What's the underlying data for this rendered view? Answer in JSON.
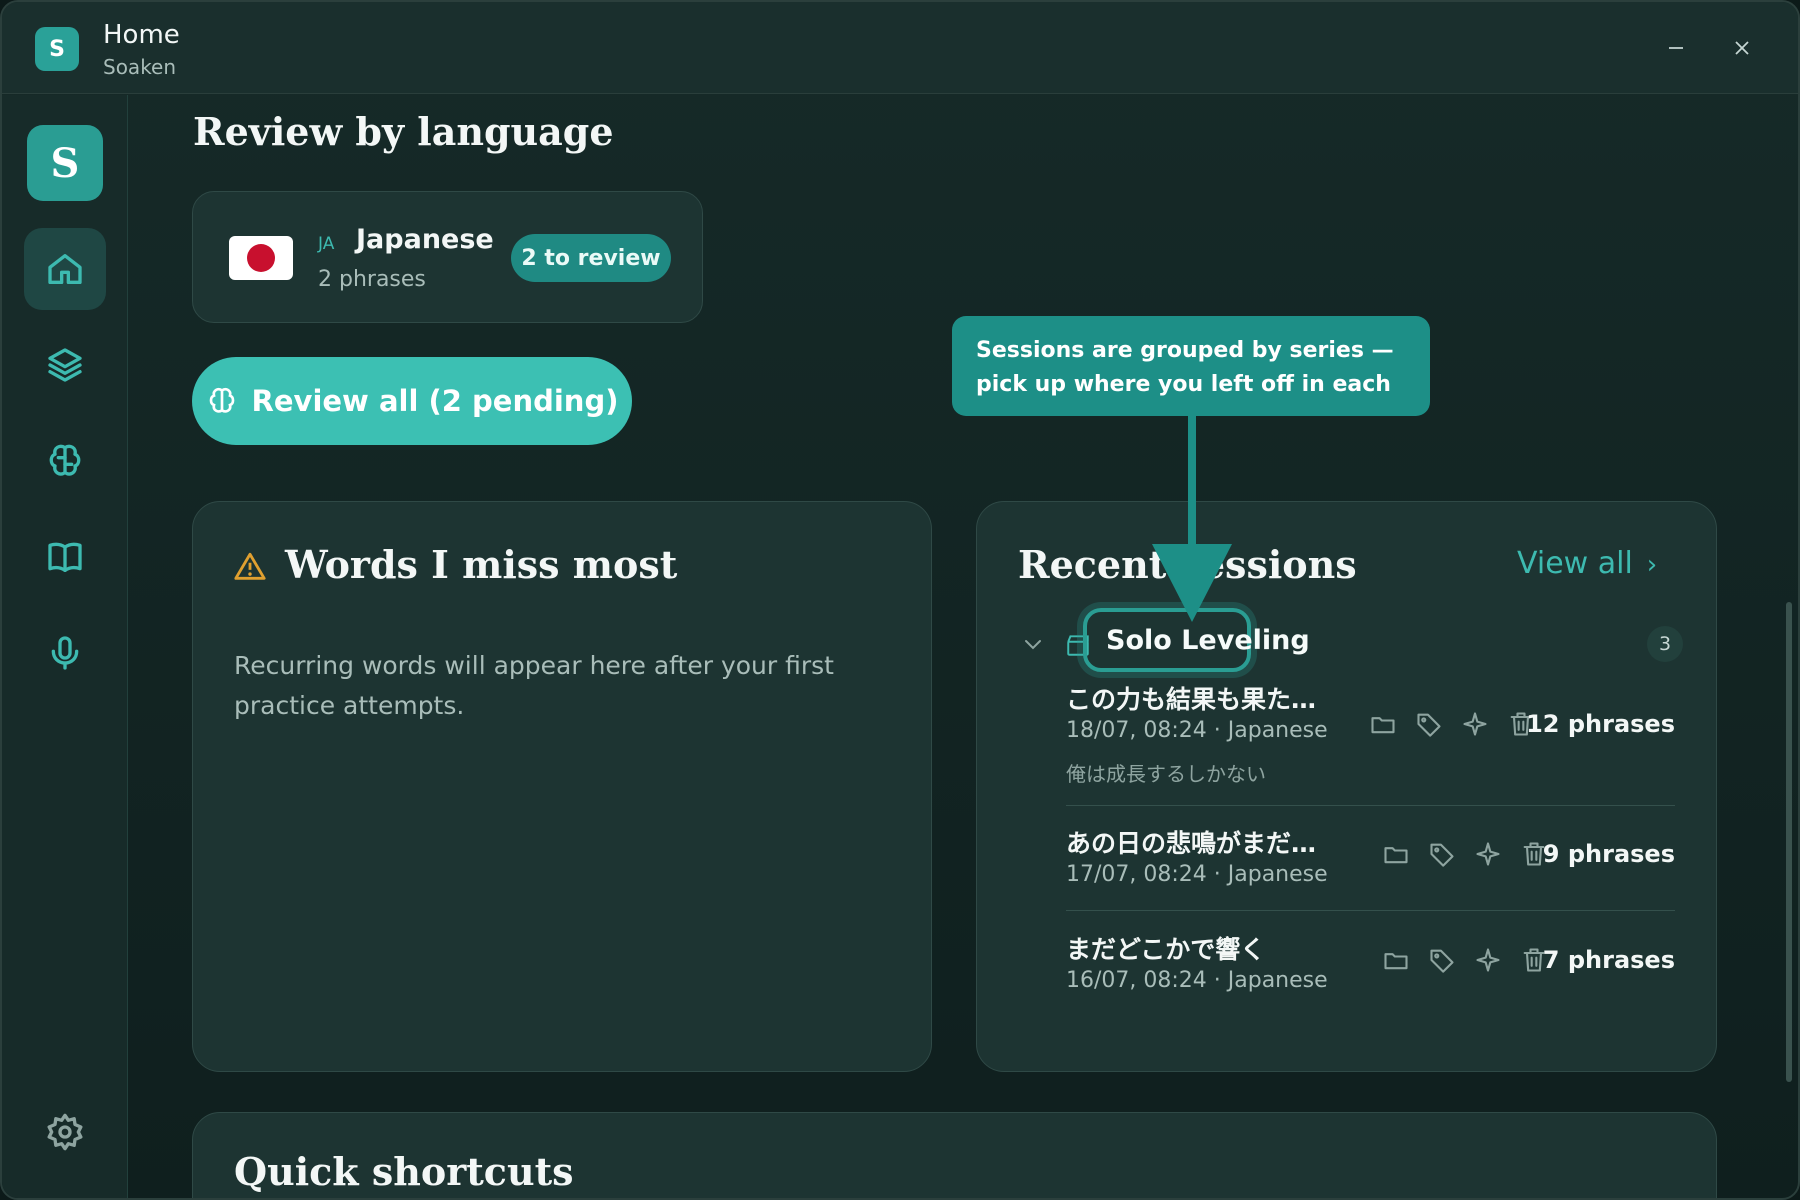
{
  "window": {
    "app_icon_letter": "S",
    "title": "Home",
    "subtitle": "Soaken"
  },
  "sidebar": {
    "logo_letter": "S",
    "items": [
      {
        "name": "home",
        "icon": "home-icon",
        "active": true
      },
      {
        "name": "decks",
        "icon": "layers-icon",
        "active": false
      },
      {
        "name": "review",
        "icon": "brain-icon",
        "active": false
      },
      {
        "name": "library",
        "icon": "book-icon",
        "active": false
      },
      {
        "name": "record",
        "icon": "microphone-icon",
        "active": false
      },
      {
        "name": "settings",
        "icon": "gear-icon",
        "active": false
      }
    ]
  },
  "review_by_language": {
    "heading": "Review by language",
    "card": {
      "code": "JA",
      "name": "Japanese",
      "phrases": "2 phrases",
      "badge": "2 to review"
    },
    "review_all_button": "Review all (2 pending)"
  },
  "words_card": {
    "title": "Words I miss most",
    "empty_text": "Recurring words will appear here after your first practice attempts."
  },
  "recent_sessions": {
    "title": "Recent sessions",
    "view_all": "View all",
    "group": {
      "series": "Solo Leveling",
      "count": "3"
    },
    "sessions": [
      {
        "title": "この力も結果も果た…",
        "meta": "18/07, 08:24 · Japanese",
        "line": "俺は成長するしかない",
        "phrases": "12 phrases"
      },
      {
        "title": "あの日の悲鳴がまだ…",
        "meta": "17/07, 08:24 · Japanese",
        "line": "",
        "phrases": "9 phrases"
      },
      {
        "title": "まだどこかで響く",
        "meta": "16/07, 08:24 · Japanese",
        "line": "",
        "phrases": "7 phrases"
      }
    ]
  },
  "tooltip": {
    "line1": "Sessions are grouped by series —",
    "line2": "pick up where you left off in each"
  },
  "quick_shortcuts": {
    "title": "Quick shortcuts"
  },
  "colors": {
    "accent": "#3cc0b3",
    "accent_dark": "#1d8f87",
    "flag_red": "#c8102e",
    "warning": "#e0a030"
  }
}
